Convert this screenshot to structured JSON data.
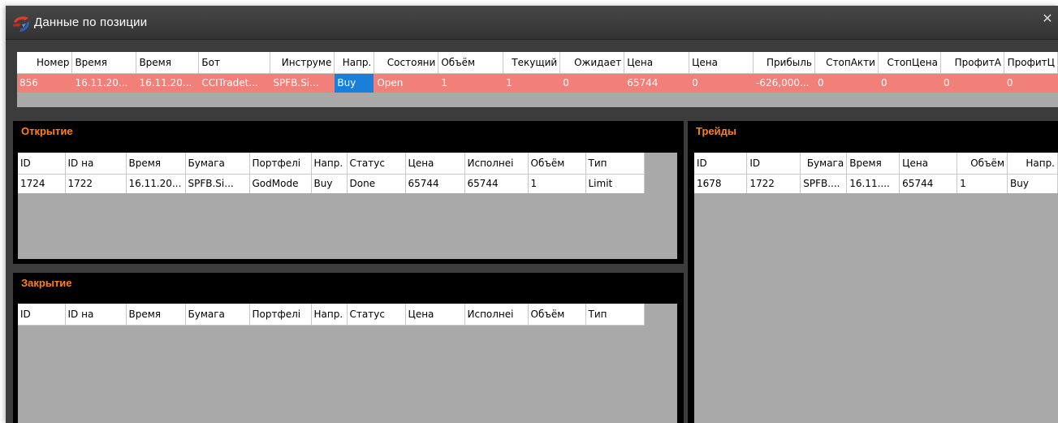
{
  "window": {
    "title": "Данные по позиции",
    "close_glyph": "✕",
    "icon": "app-logo-icon"
  },
  "position": {
    "columns": [
      "Номер",
      "Время",
      "Время",
      "Бот",
      "Инструме",
      "Напр.",
      "Состояни",
      "Объём",
      "Текущий",
      "Ожидает",
      "Цена",
      "Цена",
      "Прибыль",
      "СтопАкти",
      "СтопЦена",
      "ПрофитА",
      "ПрофитЦ"
    ],
    "row": [
      "856",
      "16.11.20...",
      "16.11.20...",
      "CCITradet...",
      "SPFB.Si...",
      "Buy",
      "Open",
      "1",
      "1",
      "0",
      "65744",
      "0",
      "-626,000...",
      "0",
      "0",
      "0",
      "0"
    ],
    "row_color": "#f08078",
    "selected_color": "#1a7fd8"
  },
  "opening": {
    "title": "Открытие",
    "columns": [
      "ID",
      "ID на",
      "Время",
      "Бумага",
      "Портфелі",
      "Напр.",
      "Статус",
      "Цена",
      "Исполнеі",
      "Объём",
      "Тип"
    ],
    "rows": [
      [
        "1724",
        "1722",
        "16.11.20...",
        "SPFB.Si...",
        "GodMode",
        "Buy",
        "Done",
        "65744",
        "65744",
        "1",
        "Limit"
      ]
    ]
  },
  "closing": {
    "title": "Закрытие",
    "columns": [
      "ID",
      "ID на",
      "Время",
      "Бумага",
      "Портфелі",
      "Напр.",
      "Статус",
      "Цена",
      "Исполнеі",
      "Объём",
      "Тип"
    ],
    "rows": []
  },
  "trades": {
    "title": "Трейды",
    "columns": [
      "ID",
      "ID",
      "Бумага",
      "Время",
      "Цена",
      "Объём",
      "Напр."
    ],
    "rows": [
      [
        "1678",
        "1722",
        "SPFB....",
        "16.11....",
        "65744",
        "1",
        "Buy"
      ]
    ]
  },
  "colors": {
    "panel_title": "#ff7f1a",
    "grid_empty": "#a9a9a9",
    "window_bg": "#3c3c3c"
  }
}
